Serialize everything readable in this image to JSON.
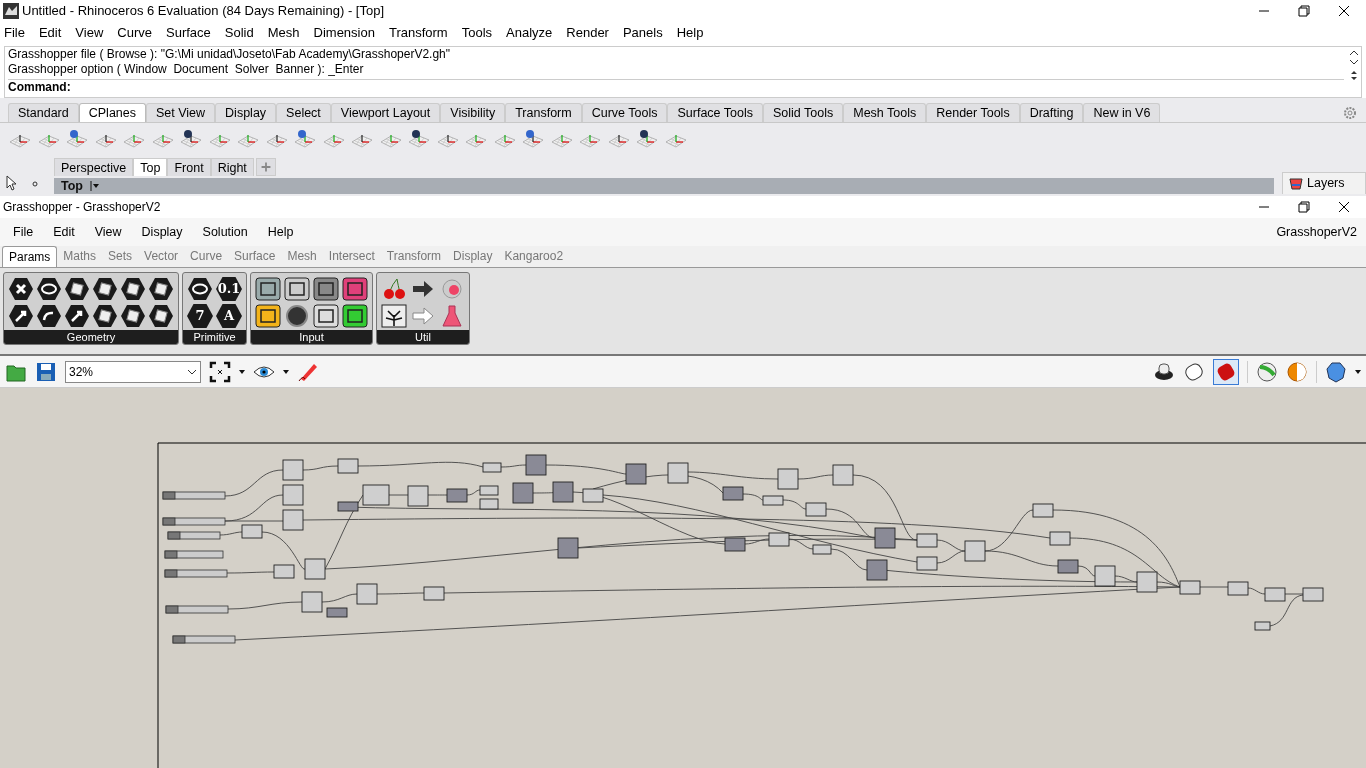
{
  "rhino": {
    "title": "Untitled - Rhinoceros 6 Evaluation (84 Days Remaining) - [Top]",
    "menu": [
      "File",
      "Edit",
      "View",
      "Curve",
      "Surface",
      "Solid",
      "Mesh",
      "Dimension",
      "Transform",
      "Tools",
      "Analyze",
      "Render",
      "Panels",
      "Help"
    ],
    "command_history": [
      "Grasshopper file ( Browse ): \"G:\\Mi unidad\\Joseto\\Fab Academy\\GrasshoperV2.gh\"",
      "Grasshopper option ( Window  Document  Solver  Banner ): _Enter"
    ],
    "command_prompt": "Command:",
    "toolbar_tabs": [
      {
        "label": "Standard",
        "selected": false
      },
      {
        "label": "CPlanes",
        "selected": true
      },
      {
        "label": "Set View",
        "selected": false
      },
      {
        "label": "Display",
        "selected": false
      },
      {
        "label": "Select",
        "selected": false
      },
      {
        "label": "Viewport Layout",
        "selected": false
      },
      {
        "label": "Visibility",
        "selected": false
      },
      {
        "label": "Transform",
        "selected": false
      },
      {
        "label": "Curve Tools",
        "selected": false
      },
      {
        "label": "Surface Tools",
        "selected": false
      },
      {
        "label": "Solid Tools",
        "selected": false
      },
      {
        "label": "Mesh Tools",
        "selected": false
      },
      {
        "label": "Render Tools",
        "selected": false
      },
      {
        "label": "Drafting",
        "selected": false
      },
      {
        "label": "New in V6",
        "selected": false
      }
    ],
    "viewport_tabs": [
      {
        "label": "Perspective",
        "selected": false
      },
      {
        "label": "Top",
        "selected": true
      },
      {
        "label": "Front",
        "selected": false
      },
      {
        "label": "Right",
        "selected": false
      }
    ],
    "viewport_title": "Top",
    "layers_tab": "Layers"
  },
  "grasshopper": {
    "title": "Grasshopper - GrasshoperV2",
    "menu": [
      "File",
      "Edit",
      "View",
      "Display",
      "Solution",
      "Help"
    ],
    "document_name": "GrasshoperV2",
    "tabs": [
      {
        "label": "Params",
        "selected": true
      },
      {
        "label": "Maths",
        "selected": false
      },
      {
        "label": "Sets",
        "selected": false
      },
      {
        "label": "Vector",
        "selected": false
      },
      {
        "label": "Curve",
        "selected": false
      },
      {
        "label": "Surface",
        "selected": false
      },
      {
        "label": "Mesh",
        "selected": false
      },
      {
        "label": "Intersect",
        "selected": false
      },
      {
        "label": "Transform",
        "selected": false
      },
      {
        "label": "Display",
        "selected": false
      },
      {
        "label": "Kangaroo2",
        "selected": false
      }
    ],
    "panel_groups": [
      {
        "label": "Geometry",
        "kind": "hex"
      },
      {
        "label": "Primitive",
        "kind": "primitive"
      },
      {
        "label": "Input",
        "kind": "input"
      },
      {
        "label": "Util",
        "kind": "util"
      }
    ],
    "primitive_glyphs": [
      "0.1",
      "7",
      "A"
    ],
    "zoom": "32%"
  }
}
